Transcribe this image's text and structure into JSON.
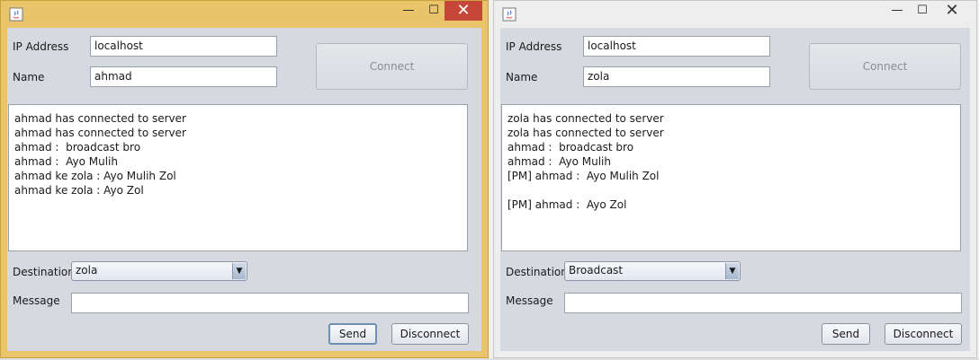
{
  "windows": [
    {
      "id": "ahmad",
      "ip_label": "IP Address",
      "ip_value": "localhost",
      "name_label": "Name",
      "name_value": "ahmad",
      "connect_label": "Connect",
      "log": [
        "ahmad has connected to server",
        "ahmad has connected to server",
        "ahmad :  broadcast bro",
        "ahmad :  Ayo Mulih",
        "ahmad ke zola : Ayo Mulih Zol",
        "ahmad ke zola : Ayo Zol"
      ],
      "destination_label": "Destination",
      "destination_value": "zola",
      "message_label": "Message",
      "message_value": "",
      "send_label": "Send",
      "disconnect_label": "Disconnect"
    },
    {
      "id": "zola",
      "ip_label": "IP Address",
      "ip_value": "localhost",
      "name_label": "Name",
      "name_value": "zola",
      "connect_label": "Connect",
      "log": [
        "zola has connected to server",
        "zola has connected to server",
        "ahmad :  broadcast bro",
        "ahmad :  Ayo Mulih",
        "[PM] ahmad :  Ayo Mulih Zol",
        "",
        "[PM] ahmad :  Ayo Zol"
      ],
      "destination_label": "Destination",
      "destination_value": "Broadcast",
      "message_label": "Message",
      "message_value": "",
      "send_label": "Send",
      "disconnect_label": "Disconnect"
    }
  ],
  "titlebar": {
    "min_glyph": "—",
    "max_glyph": "☐",
    "close_glyph": "✕"
  },
  "icons": {
    "app": "java-app-icon",
    "combo_arrow": "▼"
  }
}
